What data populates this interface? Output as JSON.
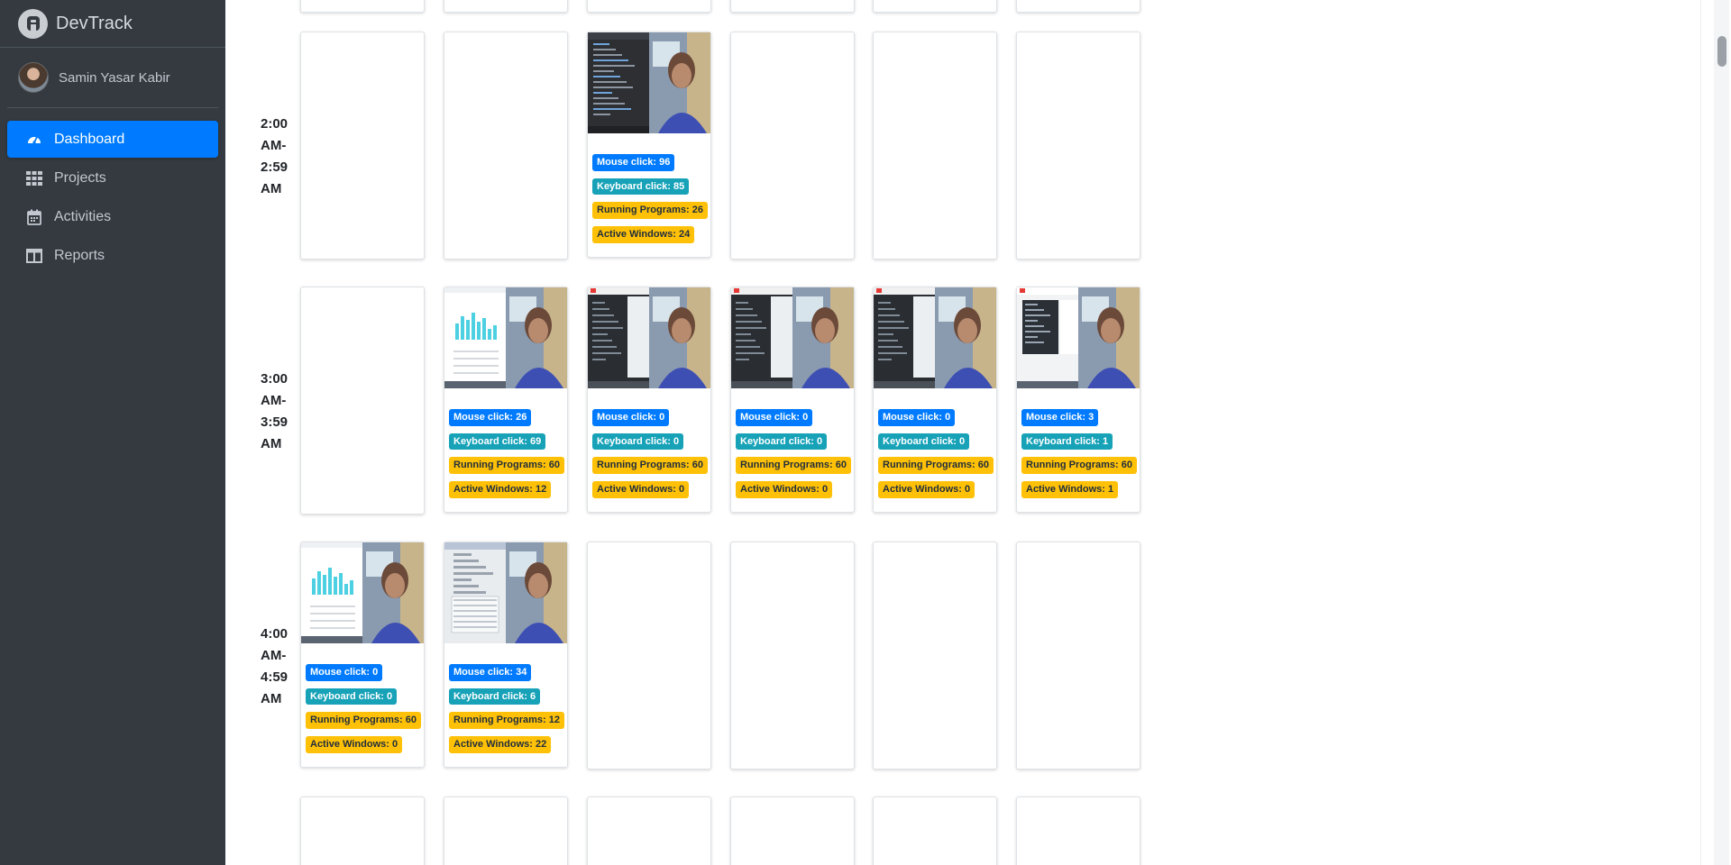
{
  "app": {
    "name": "DevTrack"
  },
  "user": {
    "name": "Samin Yasar Kabir"
  },
  "nav": [
    {
      "label": "Dashboard",
      "icon": "gauge-icon",
      "active": true
    },
    {
      "label": "Projects",
      "icon": "grid-icon",
      "active": false
    },
    {
      "label": "Activities",
      "icon": "calendar-icon",
      "active": false
    },
    {
      "label": "Reports",
      "icon": "columns-icon",
      "active": false
    }
  ],
  "colors": {
    "primary": "#007bff",
    "teal": "#17a2b8",
    "warning": "#ffc107",
    "sidebar": "#343a40"
  },
  "badge_labels": {
    "mouse": "Mouse click: ",
    "keyboard": "Keyboard click: ",
    "programs": "Running Programs: ",
    "windows": "Active Windows: "
  },
  "rows": [
    {
      "time": "2:00 AM- 2:59 AM",
      "cells": [
        null,
        null,
        {
          "screenshot": "code-editor",
          "mouse": 96,
          "keyboard": 85,
          "programs": 26,
          "windows": 24
        },
        null,
        null,
        null
      ]
    },
    {
      "time": "3:00 AM- 3:59 AM",
      "cells": [
        null,
        {
          "screenshot": "bar-chart",
          "mouse": 26,
          "keyboard": 69,
          "programs": 60,
          "windows": 12
        },
        {
          "screenshot": "dark-ide",
          "mouse": 0,
          "keyboard": 0,
          "programs": 60,
          "windows": 0
        },
        {
          "screenshot": "dark-ide",
          "mouse": 0,
          "keyboard": 0,
          "programs": 60,
          "windows": 0
        },
        {
          "screenshot": "dark-ide",
          "mouse": 0,
          "keyboard": 0,
          "programs": 60,
          "windows": 0
        },
        {
          "screenshot": "light-ide",
          "mouse": 3,
          "keyboard": 1,
          "programs": 60,
          "windows": 1
        }
      ]
    },
    {
      "time": "4:00 AM- 4:59 AM",
      "cells": [
        {
          "screenshot": "bar-chart",
          "mouse": 0,
          "keyboard": 0,
          "programs": 60,
          "windows": 0
        },
        {
          "screenshot": "file-list",
          "mouse": 34,
          "keyboard": 6,
          "programs": 12,
          "windows": 22
        },
        null,
        null,
        null,
        null
      ]
    }
  ]
}
